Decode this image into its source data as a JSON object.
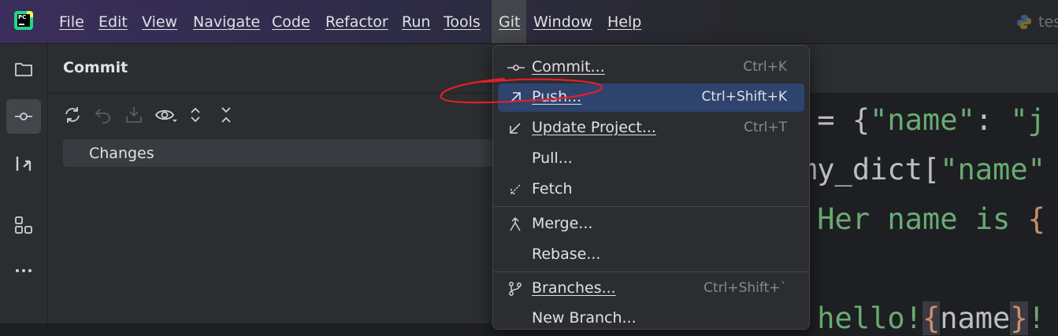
{
  "menubar": {
    "items": [
      {
        "label": "File"
      },
      {
        "label": "Edit"
      },
      {
        "label": "View"
      },
      {
        "label": "Navigate"
      },
      {
        "label": "Code"
      },
      {
        "label": "Refactor"
      },
      {
        "label": "Run"
      },
      {
        "label": "Tools"
      },
      {
        "label": "Git"
      },
      {
        "label": "Window"
      },
      {
        "label": "Help"
      }
    ],
    "logo_text": "PC",
    "project_name": "tes",
    "active_menu": "Git"
  },
  "toolstrip": {
    "icons": [
      "folder-icon",
      "commit-icon",
      "pull-requests-icon",
      "structure-icon",
      "more-icon"
    ],
    "active": "commit-icon"
  },
  "commit_panel": {
    "title": "Commit",
    "toolbar_icons": [
      "refresh-icon",
      "rollback-icon",
      "shelve-icon",
      "eye-icon",
      "expand-all-icon",
      "collapse-all-icon"
    ],
    "changes_label": "Changes"
  },
  "editor": {
    "lines": [
      {
        "parts": [
          {
            "t": " = {",
            "c": "punc"
          },
          {
            "t": "\"name\"",
            "c": "str"
          },
          {
            "t": ": ",
            "c": "punc"
          },
          {
            "t": "\"j",
            "c": "str"
          }
        ]
      },
      {
        "parts": [
          {
            "t": "my_dict[",
            "c": "punc"
          },
          {
            "t": "\"name\"",
            "c": "str"
          }
        ]
      },
      {
        "parts": [
          {
            "t": "'Her name is ",
            "c": "str"
          },
          {
            "t": "{",
            "c": "brace"
          }
        ]
      },
      {
        "parts": []
      },
      {
        "parts": [
          {
            "t": "'hello!",
            "c": "str"
          },
          {
            "t": "{",
            "c": "brace"
          },
          {
            "t": "name",
            "c": "punc"
          },
          {
            "t": "}",
            "c": "brace"
          },
          {
            "t": "!",
            "c": "str"
          }
        ]
      }
    ]
  },
  "git_menu": {
    "items": [
      {
        "label": "Commit...",
        "shortcut": "Ctrl+K",
        "icon": "commit-icon",
        "selected": false
      },
      {
        "label": "Push...",
        "shortcut": "Ctrl+Shift+K",
        "icon": "push-arrow-icon",
        "selected": true
      },
      {
        "label": "Update Project...",
        "shortcut": "Ctrl+T",
        "icon": "update-arrow-icon",
        "selected": false
      },
      {
        "label": "Pull...",
        "shortcut": "",
        "icon": "",
        "selected": false
      },
      {
        "label": "Fetch",
        "shortcut": "",
        "icon": "fetch-icon",
        "selected": false
      },
      {
        "label": "Merge...",
        "shortcut": "",
        "icon": "merge-icon",
        "selected": false
      },
      {
        "label": "Rebase...",
        "shortcut": "",
        "icon": "",
        "selected": false
      },
      {
        "label": "Branches...",
        "shortcut": "Ctrl+Shift+`",
        "icon": "branch-icon",
        "selected": false
      },
      {
        "label": "New Branch...",
        "shortcut": "",
        "icon": "",
        "selected": false
      }
    ]
  },
  "colors": {
    "accent_selection": "#2e436e",
    "annotation_stroke": "#e0202a",
    "string_green": "#6aab73",
    "brace_orange": "#cf8e6d"
  }
}
